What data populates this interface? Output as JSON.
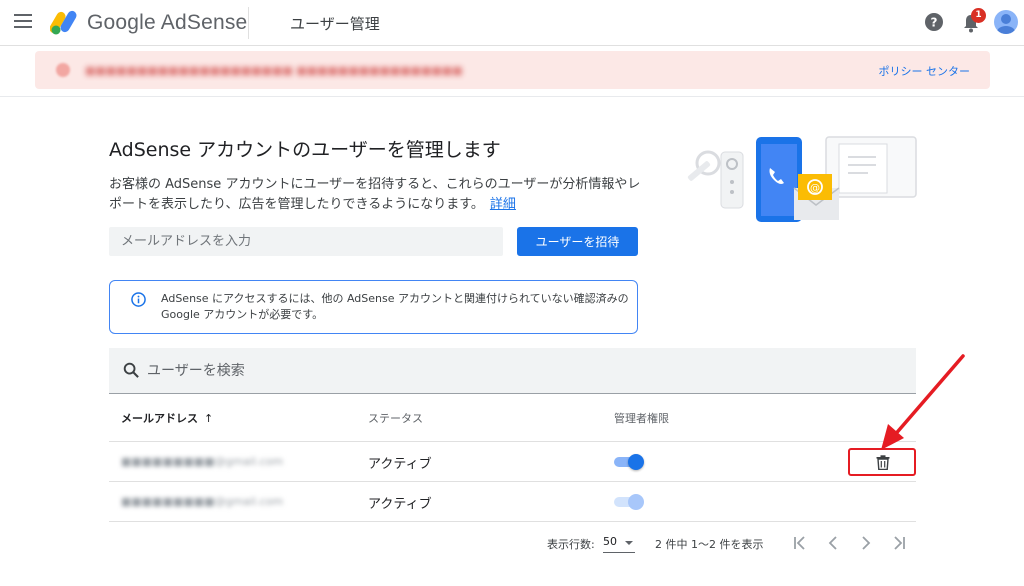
{
  "header": {
    "brand": "Google AdSense",
    "page_title": "ユーザー管理",
    "notification_count": "1"
  },
  "alert": {
    "text": "■■■■■■■■■■■■■■■■■■■■ ■■■■■■■■■■■■■■■■",
    "link": "ポリシー センター"
  },
  "intro": {
    "heading": "AdSense アカウントのユーザーを管理します",
    "description": "お客様の AdSense アカウントにユーザーを招待すると、これらのユーザーが分析情報やレポートを表示したり、広告を管理したりできるようになります。",
    "learn_more": "詳細",
    "email_placeholder": "メールアドレスを入力",
    "invite_button": "ユーザーを招待"
  },
  "info": {
    "text": "AdSense にアクセスするには、他の AdSense アカウントと関連付けられていない確認済みの Google アカウントが必要です。"
  },
  "table": {
    "search_placeholder": "ユーザーを検索",
    "columns": {
      "email": "メールアドレス",
      "sort_icon": "↑",
      "status": "ステータス",
      "admin": "管理者権限"
    },
    "rows": [
      {
        "email": "■■■■■■■■■@gmail.com",
        "status": "アクティブ",
        "admin": true,
        "admin_editable": true
      },
      {
        "email": "■■■■■■■■■@gmail.com",
        "status": "アクティブ",
        "admin": true,
        "admin_editable": false
      }
    ],
    "footer": {
      "rows_label": "表示行数:",
      "rows_value": "50",
      "range": "2 件中 1～2 件を表示"
    }
  },
  "colors": {
    "primary": "#1a73e8",
    "alert_bg": "#fce8e6",
    "annotation": "#e51c23"
  }
}
